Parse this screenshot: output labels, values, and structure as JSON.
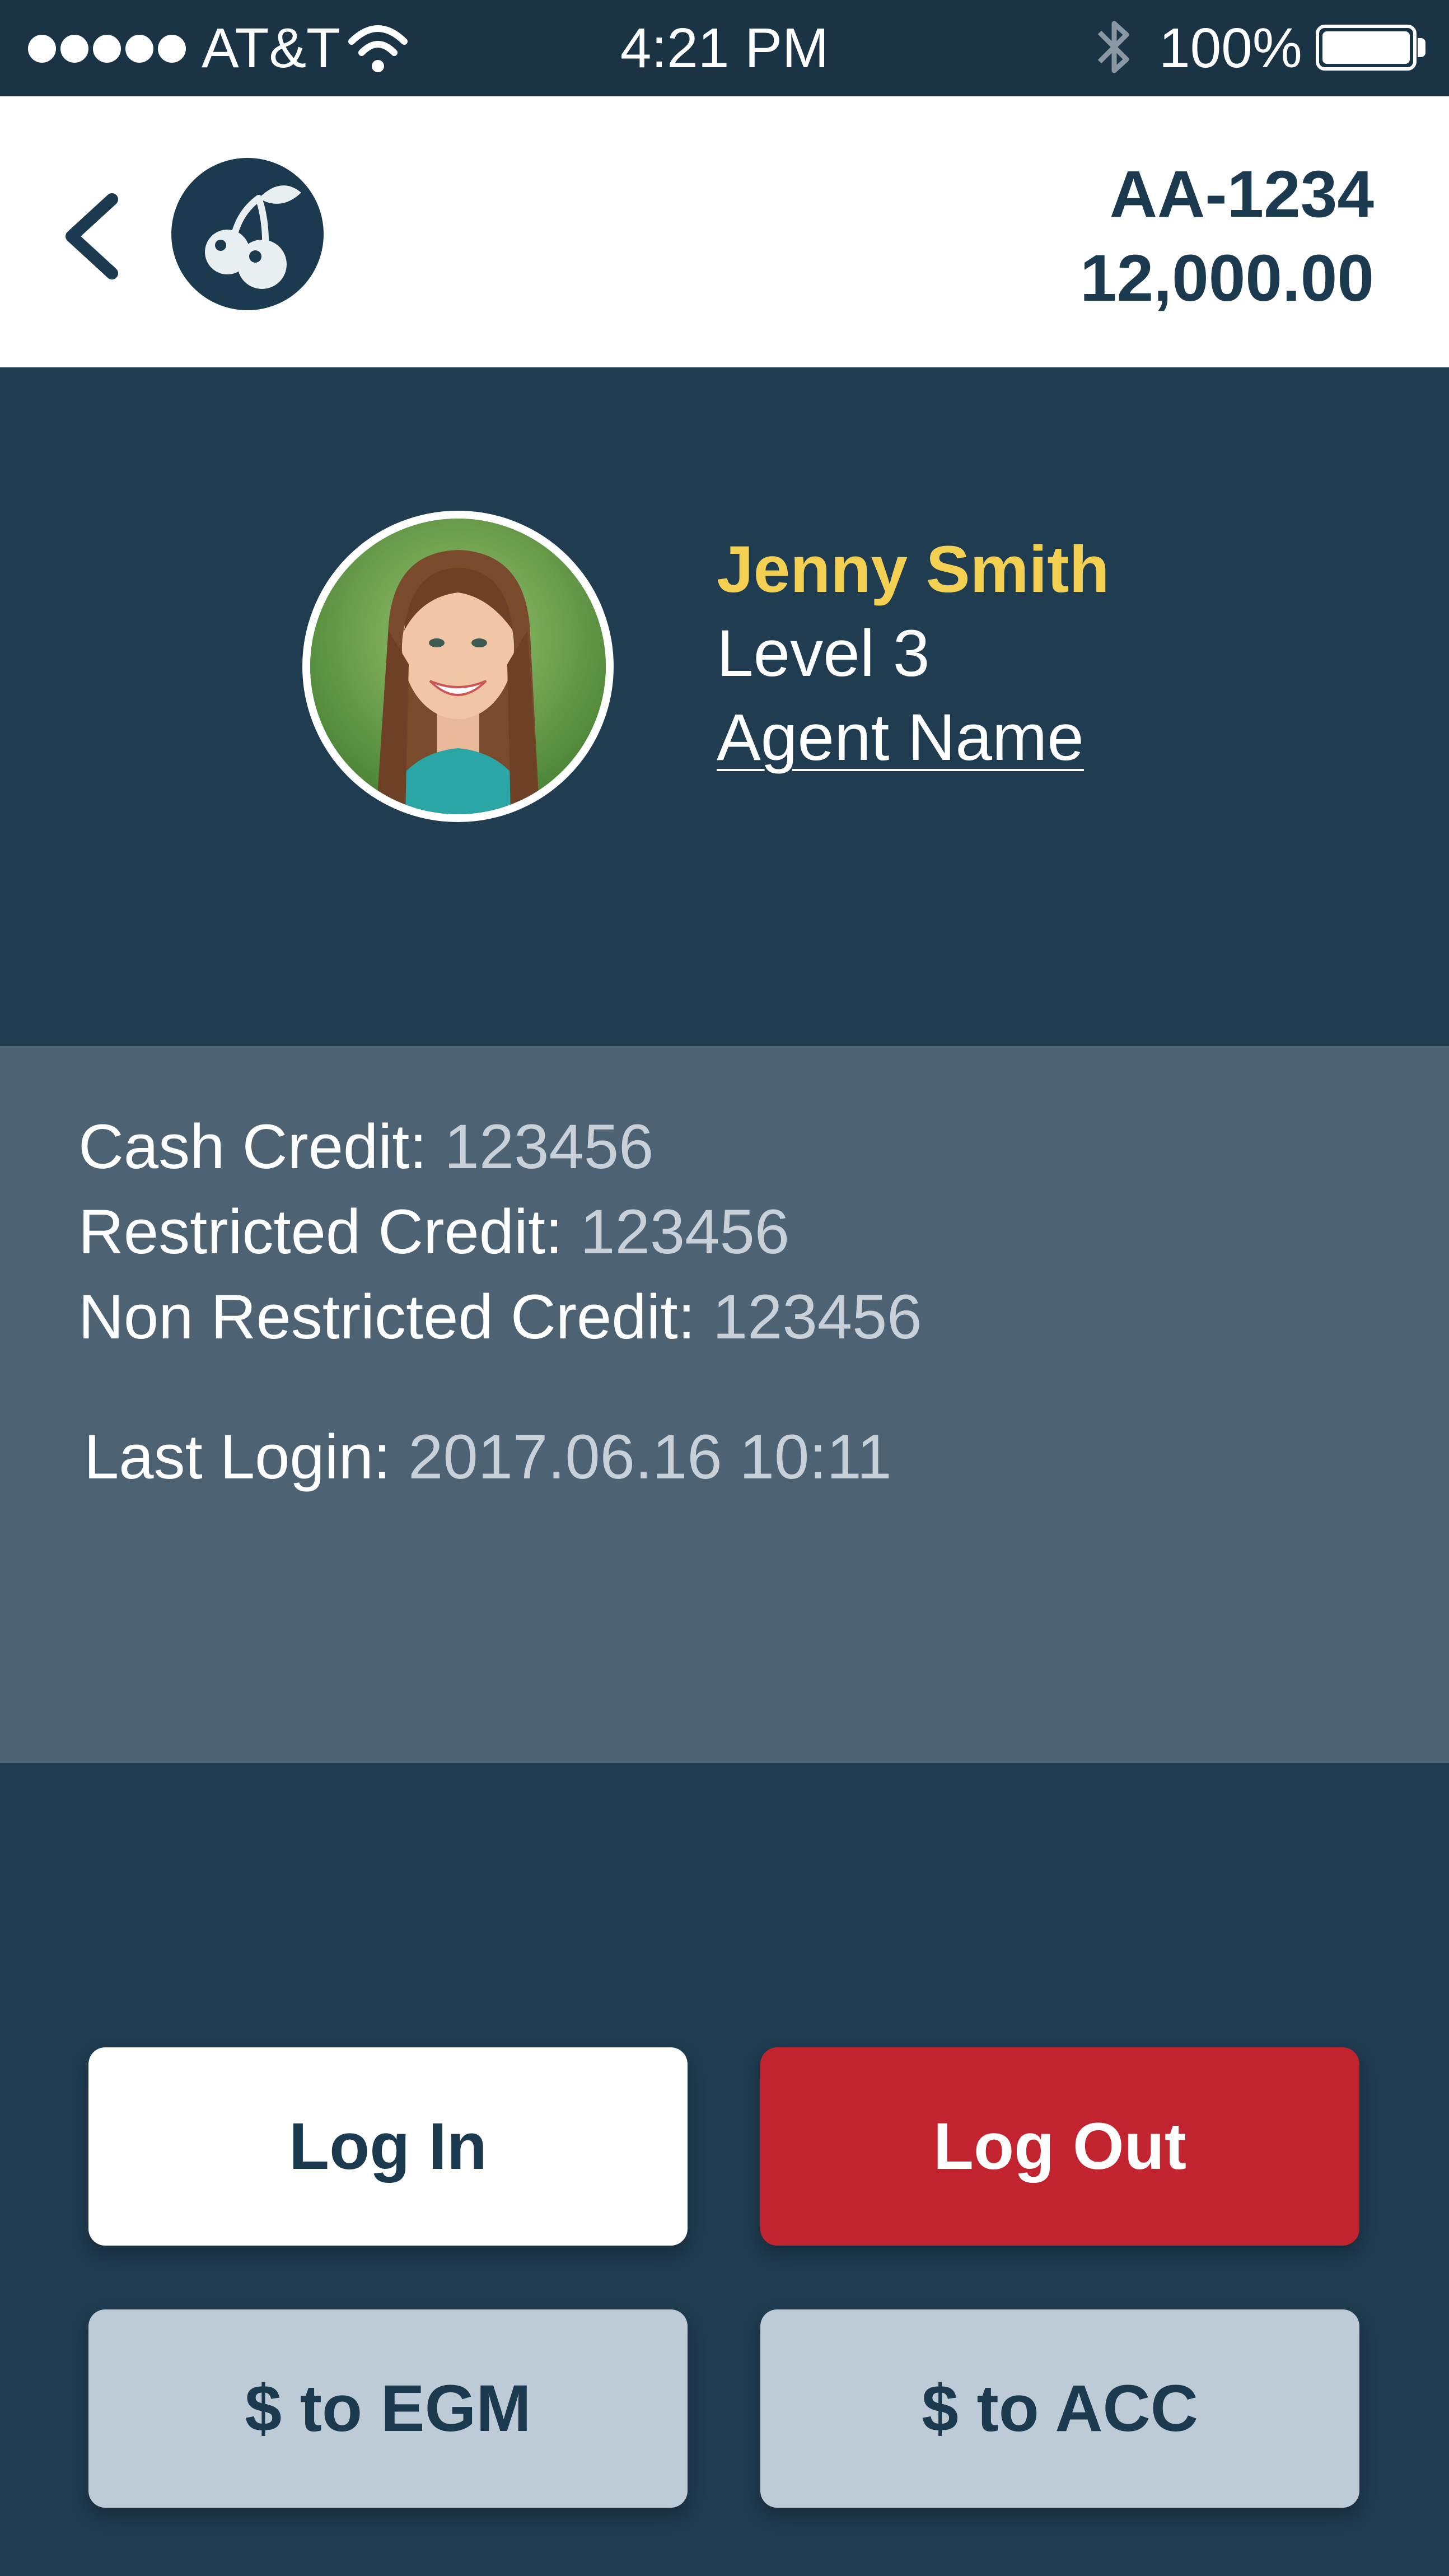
{
  "status_bar": {
    "carrier": "AT&T",
    "time": "4:21 PM",
    "battery": "100%",
    "icons": [
      "signal-dots-icon",
      "wifi-icon",
      "bluetooth-icon",
      "battery-icon"
    ]
  },
  "header": {
    "back_icon": "chevron-left-icon",
    "logo_icon": "cherry-icon",
    "account_id": "AA-1234",
    "balance": "12,000.00"
  },
  "profile": {
    "name": "Jenny Smith",
    "level": "Level 3",
    "agent_link": "Agent Name"
  },
  "credits": {
    "cash_label": "Cash Credit:",
    "cash_value": "123456",
    "restricted_label": "Restricted Credit:",
    "restricted_value": "123456",
    "non_restricted_label": "Non Restricted Credit:",
    "non_restricted_value": "123456",
    "last_login_label": "Last Login:",
    "last_login_value": "2017.06.16 10:11"
  },
  "actions": {
    "login": "Log In",
    "logout": "Log Out",
    "to_egm": "$ to EGM",
    "to_acc": "$ to ACC"
  },
  "colors": {
    "primary": "#1f3c51",
    "accent_name": "#f3cf52",
    "logout": "#c1242e",
    "secondary_button": "#bccbd5"
  }
}
